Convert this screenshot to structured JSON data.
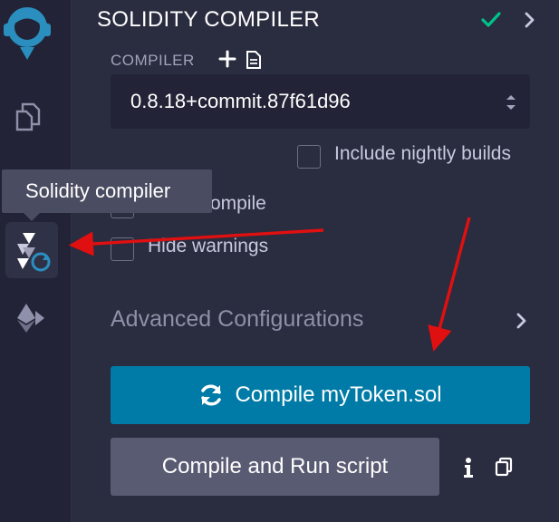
{
  "panel": {
    "title": "SOLIDITY COMPILER",
    "compiler_label": "COMPILER"
  },
  "compiler_select": {
    "value": "0.8.18+commit.87f61d96"
  },
  "options": {
    "nightly_label": "Include nightly builds",
    "auto_compile_label": "Auto compile",
    "auto_compile_visible": "ompile",
    "hide_warnings_label": "Hide warnings"
  },
  "advanced": {
    "label": "Advanced Configurations"
  },
  "buttons": {
    "compile_label": "Compile myToken.sol",
    "run_script_label": "Compile and Run script"
  },
  "tooltip": {
    "text": "Solidity compiler"
  },
  "colors": {
    "primary": "#007aa6",
    "success": "#00c28b",
    "annotation": "#e01010"
  },
  "icons": {
    "logo": "remix-logo-icon",
    "files": "files-icon",
    "solidity": "solidity-compiler-icon",
    "deploy": "ethereum-deploy-icon",
    "status": "check-icon",
    "collapse": "chevron-right-icon",
    "add": "plus-icon",
    "document": "document-icon",
    "refresh": "refresh-icon",
    "info": "info-icon",
    "copy": "copy-icon"
  }
}
